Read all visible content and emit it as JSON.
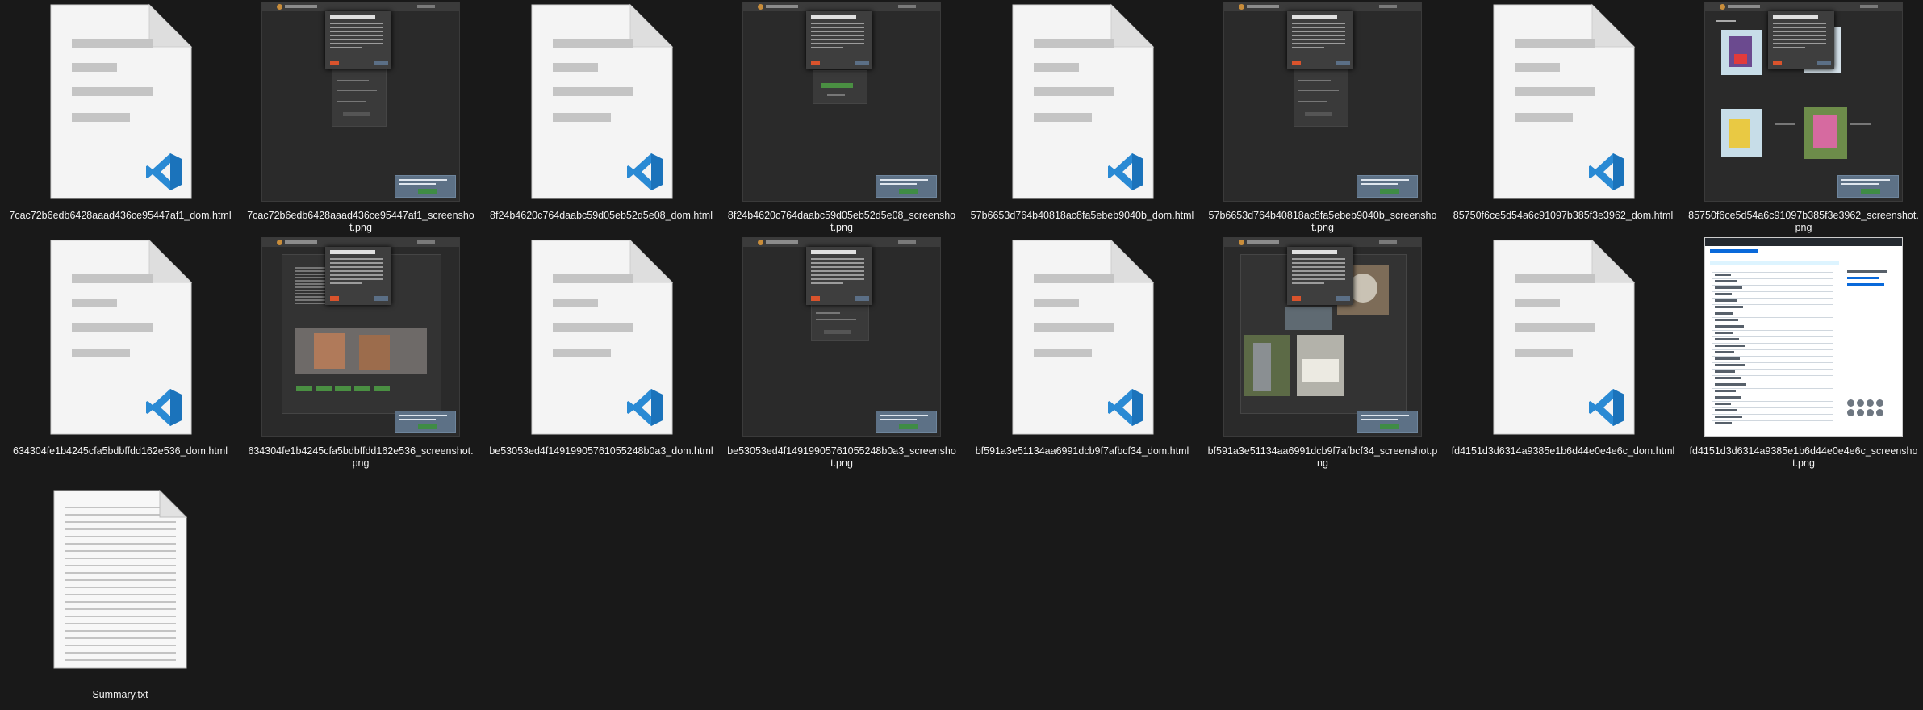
{
  "files": [
    {
      "name": "7cac72b6edb6428aaad436ce95447af1_dom.html",
      "type": "html"
    },
    {
      "name": "7cac72b6edb6428aaad436ce95447af1_screenshot.png",
      "type": "png",
      "variant": "login"
    },
    {
      "name": "8f24b4620c764daabc59d05eb52d5e08_dom.html",
      "type": "html"
    },
    {
      "name": "8f24b4620c764daabc59d05eb52d5e08_screenshot.png",
      "type": "png",
      "variant": "form-green"
    },
    {
      "name": "57b6653d764b40818ac8fa5ebeb9040b_dom.html",
      "type": "html"
    },
    {
      "name": "57b6653d764b40818ac8fa5ebeb9040b_screenshot.png",
      "type": "png",
      "variant": "login"
    },
    {
      "name": "85750f6ce5d54a6c91097b385f3e3962_dom.html",
      "type": "html"
    },
    {
      "name": "85750f6ce5d54a6c91097b385f3e3962_screenshot.png",
      "type": "png",
      "variant": "products"
    },
    {
      "name": "634304fe1b4245cfa5bdbffdd162e536_dom.html",
      "type": "html"
    },
    {
      "name": "634304fe1b4245cfa5bdbffdd162e536_screenshot.png",
      "type": "png",
      "variant": "about"
    },
    {
      "name": "be53053ed4f14919905761055248b0a3_dom.html",
      "type": "html"
    },
    {
      "name": "be53053ed4f14919905761055248b0a3_screenshot.png",
      "type": "png",
      "variant": "form"
    },
    {
      "name": "bf591a3e51134aa6991dcb9f7afbcf34_dom.html",
      "type": "html"
    },
    {
      "name": "bf591a3e51134aa6991dcb9f7afbcf34_screenshot.png",
      "type": "png",
      "variant": "photowall"
    },
    {
      "name": "fd4151d3d6314a9385e1b6d44e0e4e6c_dom.html",
      "type": "html"
    },
    {
      "name": "fd4151d3d6314a9385e1b6d44e0e4e6c_screenshot.png",
      "type": "png",
      "variant": "github"
    },
    {
      "name": "Summary.txt",
      "type": "txt"
    }
  ],
  "colors": {
    "background": "#191919",
    "vscode_blue": "#2a8ad4",
    "text": "#f2f2f2"
  },
  "icons": {
    "html": "vscode-html-file-icon",
    "png": "image-thumbnail",
    "txt": "text-file-icon"
  }
}
